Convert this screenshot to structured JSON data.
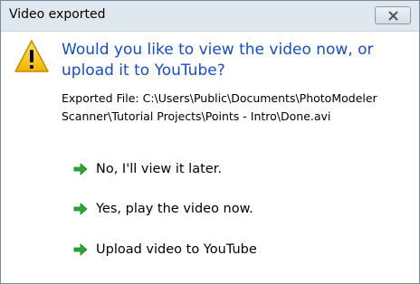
{
  "window": {
    "title": "Video exported"
  },
  "dialog": {
    "heading": "Would you like to view the video now, or upload it to YouTube?",
    "exported_file": "Exported File: C:\\Users\\Public\\Documents\\PhotoModeler Scanner\\Tutorial Projects\\Points - Intro\\Done.avi",
    "options": [
      {
        "label": "No, I'll view it later.",
        "icon": "green-arrow-icon"
      },
      {
        "label": "Yes, play the video now.",
        "icon": "green-arrow-icon"
      },
      {
        "label": "Upload video to YouTube",
        "icon": "green-arrow-icon"
      }
    ]
  },
  "icons": {
    "warning": "warning-icon",
    "close": "close-icon"
  },
  "colors": {
    "heading_text": "#1a4db8",
    "arrow": "#2aa836",
    "warning_fill": "#f5c518",
    "titlebar": "#dfe7ef"
  }
}
